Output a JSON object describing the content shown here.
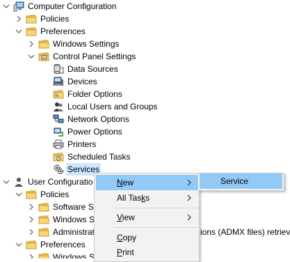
{
  "tree": {
    "computer_configuration": "Computer Configuration",
    "policies": "Policies",
    "preferences": "Preferences",
    "windows_settings": "Windows Settings",
    "control_panel_settings": "Control Panel Settings",
    "data_sources": "Data Sources",
    "devices": "Devices",
    "folder_options": "Folder Options",
    "local_users_and_groups": "Local Users and Groups",
    "network_options": "Network Options",
    "power_options": "Power Options",
    "printers": "Printers",
    "scheduled_tasks": "Scheduled Tasks",
    "services": "Services",
    "user_configuration": "User Configuratio",
    "user_policies": "Policies",
    "software_settings": "Software S",
    "user_windows_settings": "Windows S",
    "administrative_templates": "Administrat",
    "administrative_templates_suffix": "ions (ADMX files) retrieve",
    "user_preferences": "Preferences",
    "user_windows_settings_2": "Windows S"
  },
  "context_menu": {
    "new_pre": "",
    "new_key": "N",
    "new_post": "ew",
    "all_tasks_pre": "All Tas",
    "all_tasks_key": "k",
    "all_tasks_post": "s",
    "view_pre": "",
    "view_key": "V",
    "view_post": "iew",
    "copy_pre": "",
    "copy_key": "C",
    "copy_post": "opy",
    "print_pre": "",
    "print_key": "P",
    "print_post": "rint"
  },
  "submenu": {
    "service": "Service"
  },
  "colors": {
    "selection": "#cce8ff",
    "menu_highlight": "#91c9f7",
    "menu_background": "#f2f2f2",
    "folder": "#f0c24b"
  }
}
